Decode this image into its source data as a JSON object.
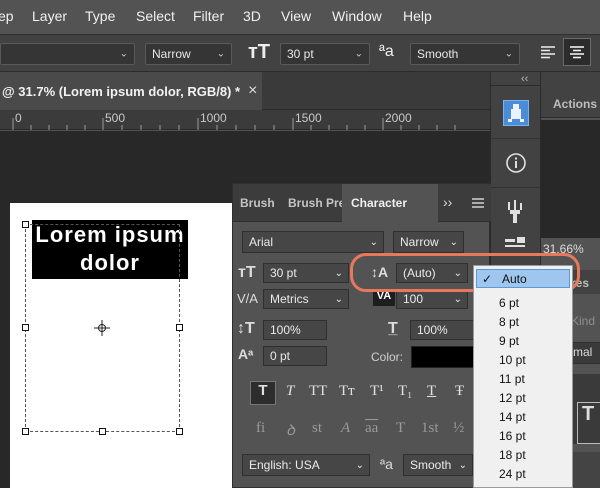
{
  "menubar": {
    "items": [
      "ep",
      "Layer",
      "Type",
      "Select",
      "Filter",
      "3D",
      "View",
      "Window",
      "Help"
    ]
  },
  "options": {
    "font_style": "Narrow",
    "font_size": "30 pt",
    "antialias": "Smooth"
  },
  "document_tab": {
    "title": "@ 31.7% (Lorem ipsum dolor, RGB/8) *",
    "close": "×"
  },
  "ruler": {
    "labels": [
      "0",
      "500",
      "1000",
      "1500",
      "2000"
    ]
  },
  "canvas": {
    "text_line1": "Lorem ipsum",
    "text_line2": "dolor"
  },
  "character_panel": {
    "tabs": [
      "Brush",
      "Brush Pre",
      "Character"
    ],
    "overflow": "››",
    "font_family": "Arial",
    "font_style": "Narrow",
    "font_size": "30 pt",
    "leading": "(Auto)",
    "kerning": "Metrics",
    "tracking": "100",
    "vertical_scale": "100%",
    "horizontal_scale": "100%",
    "baseline_shift": "0 pt",
    "color_label": "Color:",
    "color": "#000000",
    "language": "English: USA",
    "antialias": "Smooth",
    "style_buttons": [
      "T",
      "T",
      "TT",
      "Tт",
      "T¹",
      "T₁",
      "T",
      "Ŧ"
    ],
    "opentype_buttons": [
      "fi",
      "ꝺ",
      "st",
      "A",
      "aa",
      "T",
      "1st",
      "½"
    ],
    "aa_label": "ªa"
  },
  "leading_menu": {
    "items": [
      "Auto",
      "6 pt",
      "8 pt",
      "9 pt",
      "10 pt",
      "11 pt",
      "12 pt",
      "14 pt",
      "16 pt",
      "18 pt",
      "24 pt"
    ],
    "selected": "Auto",
    "check": "✓"
  },
  "right_panels": {
    "actions_label": "Actions",
    "zoom": "31.66%",
    "partial_label_1": "res",
    "partial_label_2": "Kind",
    "partial_label_3": "rmal",
    "collapse": "‹‹"
  },
  "colors": {
    "accent": "#e8785c",
    "menu_highlight": "#9ec6ef"
  }
}
